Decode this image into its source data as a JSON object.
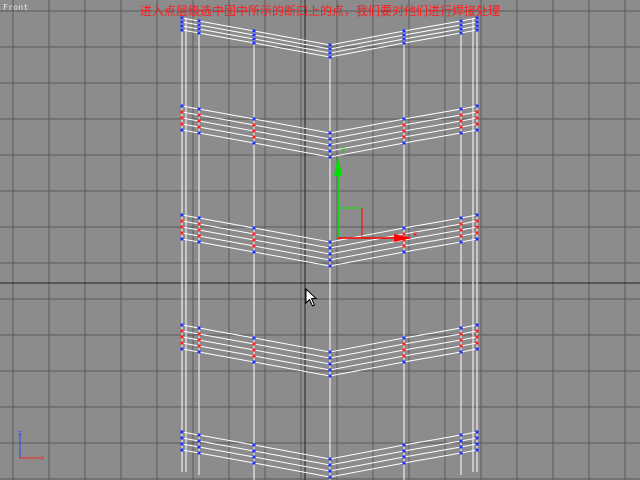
{
  "viewport": {
    "label": "Front",
    "background": "#8c8c8c"
  },
  "instruction_caption": "进入点层级选中图中所示的断口上的点，我们要对他们进行焊接处理",
  "axis_tripod": {
    "up_label": "z",
    "right_label": "x"
  },
  "transform_gizmo": {
    "x_label": "x",
    "y_label": "y",
    "x_color": "#ff0000",
    "y_color": "#00ff00"
  },
  "colors": {
    "wire": "#ffffff",
    "vertex": "#2030ff",
    "selected_vertex": "#ff2020",
    "grid_major": "#222222",
    "grid_minor": "#5a5a5a",
    "caption": "#ff1a1a"
  },
  "icons": {
    "cursor": "arrow-cursor-icon"
  }
}
